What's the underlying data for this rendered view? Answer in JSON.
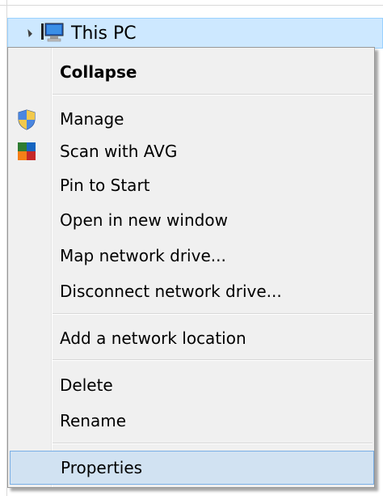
{
  "tree": {
    "expander_icon": "expanded-triangle-icon",
    "item_icon": "computer-icon",
    "label": "This PC"
  },
  "menu": {
    "items": [
      {
        "label": "Collapse",
        "bold": true
      },
      {
        "label": "Manage",
        "icon": "uac-shield-icon"
      },
      {
        "label": "Scan with AVG",
        "icon": "avg-icon"
      },
      {
        "label": "Pin to Start"
      },
      {
        "label": "Open in new window"
      },
      {
        "label": "Map network drive..."
      },
      {
        "label": "Disconnect network drive..."
      },
      {
        "label": "Add a network location"
      },
      {
        "label": "Delete"
      },
      {
        "label": "Rename"
      },
      {
        "label": "Properties",
        "highlighted": true
      }
    ]
  },
  "colors": {
    "selection_bg": "#cde8ff",
    "menu_bg": "#f0f0f0",
    "hover_bg": "#d1e2f2",
    "hover_border": "#78aee5"
  }
}
